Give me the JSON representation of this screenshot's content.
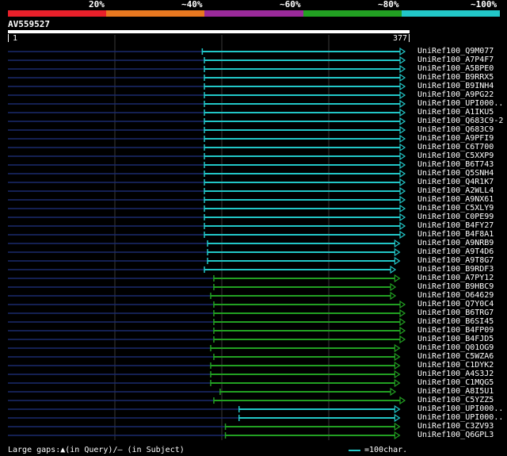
{
  "scale": {
    "labels": [
      "20%",
      "~40%",
      "~60%",
      "~80%",
      "~100%"
    ],
    "colors": [
      "#e8202a",
      "#e87820",
      "#9a2a9a",
      "#22a022",
      "#22c7c8"
    ]
  },
  "query": {
    "name": "AV559527",
    "start": "1",
    "end": "377",
    "length": 377
  },
  "hits": [
    {
      "label": "UniRef100_Q9M077",
      "start": 185,
      "end": 377,
      "color": "#22c7c8"
    },
    {
      "label": "UniRef100_A7P4F7",
      "start": 187,
      "end": 377,
      "color": "#22c7c8"
    },
    {
      "label": "UniRef100_A5BPE0",
      "start": 187,
      "end": 377,
      "color": "#22c7c8"
    },
    {
      "label": "UniRef100_B9RRX5",
      "start": 187,
      "end": 377,
      "color": "#22c7c8"
    },
    {
      "label": "UniRef100_B9INH4",
      "start": 187,
      "end": 377,
      "color": "#22c7c8"
    },
    {
      "label": "UniRef100_A9PG22",
      "start": 187,
      "end": 377,
      "color": "#22c7c8"
    },
    {
      "label": "UniRef100_UPI000..",
      "start": 187,
      "end": 377,
      "color": "#22c7c8"
    },
    {
      "label": "UniRef100_A1IKU5",
      "start": 187,
      "end": 377,
      "color": "#22c7c8"
    },
    {
      "label": "UniRef100_Q683C9-2",
      "start": 187,
      "end": 377,
      "color": "#22c7c8"
    },
    {
      "label": "UniRef100_Q683C9",
      "start": 187,
      "end": 377,
      "color": "#22c7c8"
    },
    {
      "label": "UniRef100_A9PFI9",
      "start": 187,
      "end": 377,
      "color": "#22c7c8"
    },
    {
      "label": "UniRef100_C6T700",
      "start": 187,
      "end": 377,
      "color": "#22c7c8"
    },
    {
      "label": "UniRef100_C5XXP9",
      "start": 187,
      "end": 377,
      "color": "#22c7c8"
    },
    {
      "label": "UniRef100_B6T743",
      "start": 187,
      "end": 377,
      "color": "#22c7c8"
    },
    {
      "label": "UniRef100_Q5SNH4",
      "start": 187,
      "end": 377,
      "color": "#22c7c8"
    },
    {
      "label": "UniRef100_Q4R1K7",
      "start": 187,
      "end": 377,
      "color": "#22c7c8"
    },
    {
      "label": "UniRef100_A2WLL4",
      "start": 187,
      "end": 377,
      "color": "#22c7c8"
    },
    {
      "label": "UniRef100_A9NX61",
      "start": 187,
      "end": 377,
      "color": "#22c7c8"
    },
    {
      "label": "UniRef100_C5XLY9",
      "start": 187,
      "end": 377,
      "color": "#22c7c8"
    },
    {
      "label": "UniRef100_C0PE99",
      "start": 187,
      "end": 377,
      "color": "#22c7c8"
    },
    {
      "label": "UniRef100_B4FY27",
      "start": 187,
      "end": 377,
      "color": "#22c7c8"
    },
    {
      "label": "UniRef100_B4F8A1",
      "start": 187,
      "end": 377,
      "color": "#22c7c8"
    },
    {
      "label": "UniRef100_A9NRB9",
      "start": 190,
      "end": 372,
      "color": "#22c7c8"
    },
    {
      "label": "UniRef100_A9T4D6",
      "start": 190,
      "end": 372,
      "color": "#22c7c8"
    },
    {
      "label": "UniRef100_A9T8G7",
      "start": 190,
      "end": 372,
      "color": "#22c7c8"
    },
    {
      "label": "UniRef100_B9RDF3",
      "start": 187,
      "end": 368,
      "color": "#22c7c8"
    },
    {
      "label": "UniRef100_A7PY12",
      "start": 196,
      "end": 372,
      "color": "#22a022"
    },
    {
      "label": "UniRef100_B9HBC9",
      "start": 196,
      "end": 368,
      "color": "#22a022"
    },
    {
      "label": "UniRef100_O64629",
      "start": 193,
      "end": 368,
      "color": "#22a022"
    },
    {
      "label": "UniRef100_Q7Y0C4",
      "start": 196,
      "end": 377,
      "color": "#22a022"
    },
    {
      "label": "UniRef100_B6TRG7",
      "start": 196,
      "end": 377,
      "color": "#22a022"
    },
    {
      "label": "UniRef100_B6SI45",
      "start": 196,
      "end": 377,
      "color": "#22a022"
    },
    {
      "label": "UniRef100_B4FP09",
      "start": 196,
      "end": 377,
      "color": "#22a022"
    },
    {
      "label": "UniRef100_B4FJD5",
      "start": 196,
      "end": 377,
      "color": "#22a022"
    },
    {
      "label": "UniRef100_Q01OG9",
      "start": 193,
      "end": 372,
      "color": "#22a022"
    },
    {
      "label": "UniRef100_C5WZA6",
      "start": 196,
      "end": 372,
      "color": "#22a022"
    },
    {
      "label": "UniRef100_C1DYK2",
      "start": 193,
      "end": 372,
      "color": "#22a022"
    },
    {
      "label": "UniRef100_A4S3J2",
      "start": 193,
      "end": 372,
      "color": "#22a022"
    },
    {
      "label": "UniRef100_C1MQG5",
      "start": 193,
      "end": 372,
      "color": "#22a022"
    },
    {
      "label": "UniRef100_A8I5U1",
      "start": 202,
      "end": 368,
      "color": "#22a022"
    },
    {
      "label": "UniRef100_C5YZZ5",
      "start": 196,
      "end": 377,
      "color": "#22a022"
    },
    {
      "label": "UniRef100_UPI000..",
      "start": 220,
      "end": 372,
      "color": "#22c7c8"
    },
    {
      "label": "UniRef100_UPI000..",
      "start": 220,
      "end": 372,
      "color": "#22c7c8"
    },
    {
      "label": "UniRef100_C3ZV93",
      "start": 207,
      "end": 372,
      "color": "#22a022"
    },
    {
      "label": "UniRef100_Q6GPL3",
      "start": 207,
      "end": 372,
      "color": "#22a022"
    }
  ],
  "legend": {
    "gaps_text": "Large gaps:▲(in Query)/– (in Subject)",
    "scale_text": "=100char."
  }
}
